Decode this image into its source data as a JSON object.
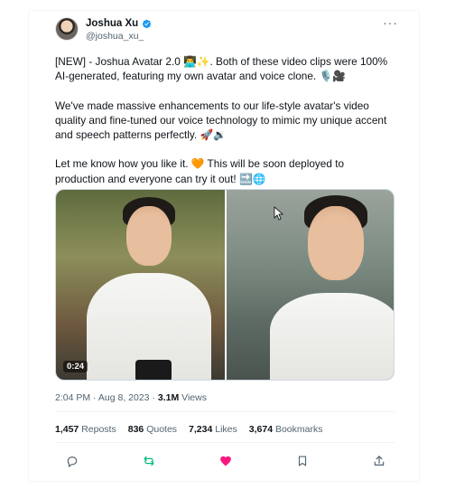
{
  "author": {
    "name": "Joshua Xu",
    "handle": "@joshua_xu_",
    "verified_icon": "verified-badge-icon",
    "more_label": "···"
  },
  "tweet": {
    "paragraphs": [
      "[NEW] - Joshua Avatar 2.0 👨‍💻✨. Both of these video clips were 100% AI-generated, featuring my own avatar and voice clone. 🎙️🎥",
      "We've made massive enhancements to our life-style avatar's video quality and fine-tuned our voice technology to mimic my unique accent and speech patterns perfectly. 🚀🔉",
      "Let me know how you like it. 🧡 This will be soon deployed to production and everyone can try it out! 🔜🌐"
    ]
  },
  "media": {
    "duration": "0:24"
  },
  "meta": {
    "time": "2:04 PM",
    "separator": "·",
    "date": "Aug 8, 2023",
    "views_count": "3.1M",
    "views_label": "Views"
  },
  "stats": {
    "reposts_count": "1,457",
    "reposts_label": "Reposts",
    "quotes_count": "836",
    "quotes_label": "Quotes",
    "likes_count": "7,234",
    "likes_label": "Likes",
    "bookmarks_count": "3,674",
    "bookmarks_label": "Bookmarks"
  },
  "actions": [
    {
      "name": "reply",
      "icon": "reply-icon",
      "color": "#536471"
    },
    {
      "name": "repost",
      "icon": "repost-icon",
      "color": "#00ba7c"
    },
    {
      "name": "like",
      "icon": "heart-icon",
      "color": "#f91880"
    },
    {
      "name": "bookmark",
      "icon": "bookmark-icon",
      "color": "#536471"
    },
    {
      "name": "share",
      "icon": "share-icon",
      "color": "#536471"
    }
  ],
  "colors": {
    "text": "#0f1419",
    "secondary": "#536471",
    "verified": "#1d9bf0",
    "repost_active": "#00ba7c",
    "like_active": "#f91880"
  }
}
